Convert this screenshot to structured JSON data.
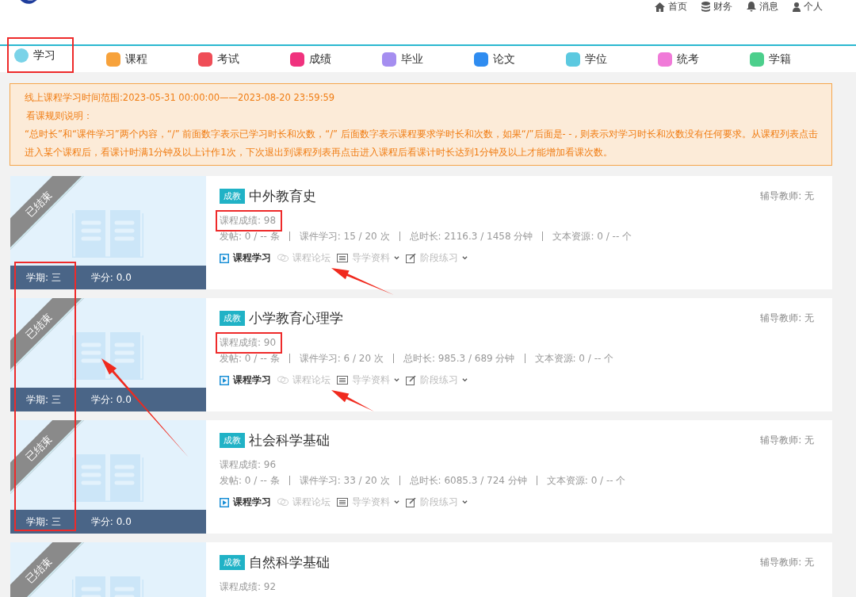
{
  "top_links": [
    {
      "kind": "home",
      "label": "首页"
    },
    {
      "kind": "finance",
      "label": "财务"
    },
    {
      "kind": "bell",
      "label": "消息"
    },
    {
      "kind": "user",
      "label": "个人"
    }
  ],
  "tabs": [
    {
      "label": "学习",
      "selected": true,
      "highlighted": true,
      "color": "#7ad3e8"
    },
    {
      "label": "课程",
      "selected": false,
      "highlighted": false,
      "color": "#f7a23b"
    },
    {
      "label": "考试",
      "selected": false,
      "highlighted": false,
      "color": "#ef4d57"
    },
    {
      "label": "成绩",
      "selected": false,
      "highlighted": false,
      "color": "#f0327e"
    },
    {
      "label": "毕业",
      "selected": false,
      "highlighted": false,
      "color": "#a58ef0"
    },
    {
      "label": "论文",
      "selected": false,
      "highlighted": false,
      "color": "#2f8cf0"
    },
    {
      "label": "学位",
      "selected": false,
      "highlighted": false,
      "color": "#5cc9e0"
    },
    {
      "label": "统考",
      "selected": false,
      "highlighted": false,
      "color": "#f07ad8"
    },
    {
      "label": "学籍",
      "selected": false,
      "highlighted": false,
      "color": "#4ccf8c"
    }
  ],
  "notice": {
    "lines": [
      "线上课程学习时间范围:2023-05-31 00:00:00——2023-08-20 23:59:59",
      "看课规则说明：",
      "“总时长”和“课件学习”两个内容，“/” 前面数字表示已学习时长和次数，“/” 后面数字表示课程要求学时长和次数，如果“/”后面是- - , 则表示对学习时长和次数没有任何要求。从课程列表点击进入某个课程后，看课计时满1分钟及以上计作1次，下次退出到课程列表再点击进入课程后看课计时长达到1分钟及以上才能增加看课次数。"
    ]
  },
  "courses": [
    {
      "status": "已结束",
      "term": "学期: 三",
      "credit": "学分: 0.0",
      "tag": "成教",
      "title": "中外教育史",
      "teacher": "辅导教师: 无",
      "score": "课程成绩: 98",
      "score_highlighted": true,
      "stats": [
        "发帖: 0 / -- 条",
        "课件学习: 15 / 20 次",
        "总时长: 2116.3 / 1458 分钟",
        "文本资源: 0 / -- 个"
      ],
      "actions": [
        {
          "kind": "video",
          "label": "课程学习",
          "disabled": false,
          "menu": false
        },
        {
          "kind": "forum",
          "label": "课程论坛",
          "disabled": true,
          "menu": false
        },
        {
          "kind": "guide",
          "label": "导学资料",
          "disabled": true,
          "menu": true
        },
        {
          "kind": "exercise",
          "label": "阶段练习",
          "disabled": true,
          "menu": true
        }
      ]
    },
    {
      "status": "已结束",
      "term": "学期: 三",
      "credit": "学分: 0.0",
      "tag": "成教",
      "title": "小学教育心理学",
      "teacher": "辅导教师: 无",
      "score": "课程成绩: 90",
      "score_highlighted": true,
      "stats": [
        "发帖: 0 / -- 条",
        "课件学习: 6 / 20 次",
        "总时长: 985.3 / 689 分钟",
        "文本资源: 0 / -- 个"
      ],
      "actions": [
        {
          "kind": "video",
          "label": "课程学习",
          "disabled": false,
          "menu": false
        },
        {
          "kind": "forum",
          "label": "课程论坛",
          "disabled": true,
          "menu": false
        },
        {
          "kind": "guide",
          "label": "导学资料",
          "disabled": true,
          "menu": true
        },
        {
          "kind": "exercise",
          "label": "阶段练习",
          "disabled": true,
          "menu": true
        }
      ]
    },
    {
      "status": "已结束",
      "term": "学期: 三",
      "credit": "学分: 0.0",
      "tag": "成教",
      "title": "社会科学基础",
      "teacher": "辅导教师: 无",
      "score": "课程成绩: 96",
      "score_highlighted": false,
      "stats": [
        "发帖: 0 / -- 条",
        "课件学习: 33 / 20 次",
        "总时长: 6085.3 / 724 分钟",
        "文本资源: 0 / -- 个"
      ],
      "actions": [
        {
          "kind": "video",
          "label": "课程学习",
          "disabled": false,
          "menu": false
        },
        {
          "kind": "forum",
          "label": "课程论坛",
          "disabled": true,
          "menu": false
        },
        {
          "kind": "guide",
          "label": "导学资料",
          "disabled": true,
          "menu": true
        },
        {
          "kind": "exercise",
          "label": "阶段练习",
          "disabled": true,
          "menu": true
        }
      ]
    },
    {
      "status": "已结束",
      "tag": "成教",
      "title": "自然科学基础",
      "teacher": "辅导教师: 无",
      "score": "课程成绩: 92",
      "score_highlighted": false
    }
  ],
  "annotations": [
    {
      "kind": "arrow"
    },
    {
      "kind": "arrow"
    },
    {
      "kind": "arrow"
    },
    {
      "kind": "term-box"
    }
  ]
}
